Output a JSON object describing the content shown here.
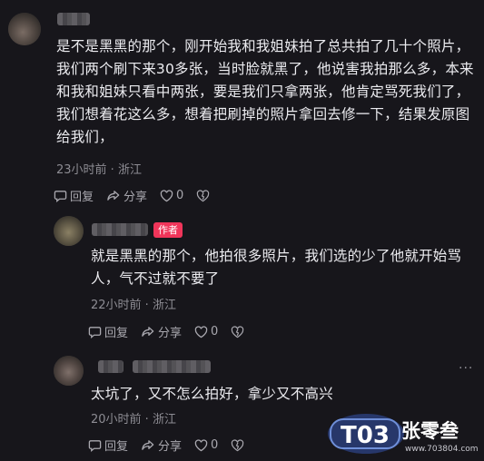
{
  "comments": [
    {
      "text": "是不是黑黑的那个，刚开始我和我姐妹拍了总共拍了几十个照片，我们两个刷下来30多张，当时脸就黑了，他说害我拍那么多，本来和我和姐妹只看中两张，要是我们只拿两张，他肯定骂死我们了，我们想着花这么多，想着把刷掉的照片拿回去修一下，结果发原图给我们，",
      "meta": "23小时前 · 浙江",
      "reply_label": "回复",
      "share_label": "分享",
      "like_count": "0"
    },
    {
      "badge": "作者",
      "text": "就是黑黑的那个，他拍很多照片，我们选的少了他就开始骂人，气不过就不要了",
      "meta": "22小时前 · 浙江",
      "reply_label": "回复",
      "share_label": "分享",
      "like_count": "0"
    },
    {
      "text": "太坑了，又不怎么拍好，拿少又不高兴",
      "meta": "20小时前 · 浙江",
      "reply_label": "回复",
      "share_label": "分享",
      "like_count": "0",
      "more": "···"
    }
  ],
  "watermark": {
    "logo": "T03",
    "name": "张零叁",
    "url": "www.703804.com"
  },
  "colors": {
    "background": "#17161b",
    "badge": "#f0355a",
    "meta": "#8d8c93"
  }
}
